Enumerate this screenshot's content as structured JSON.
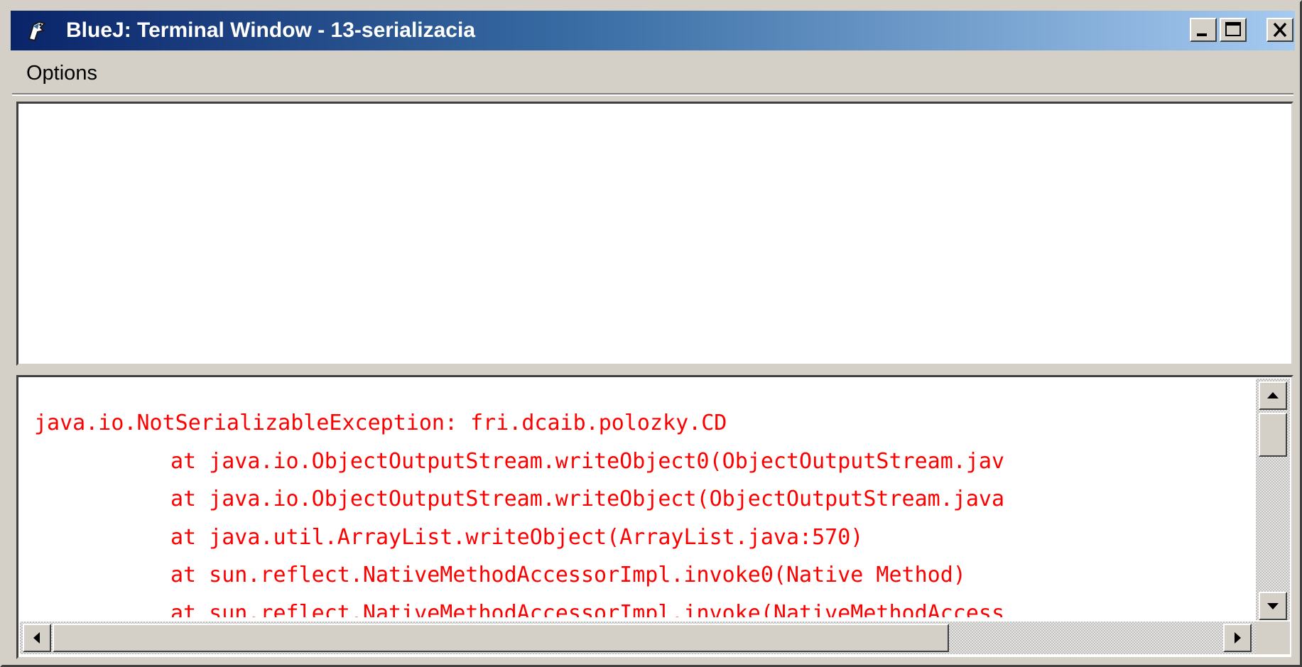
{
  "window": {
    "title": "BlueJ: Terminal Window - 13-serializacia",
    "icon": "bluej-bird-icon",
    "controls": [
      "minimize-icon",
      "maximize-icon",
      "close-icon"
    ]
  },
  "menu": {
    "options_label": "Options"
  },
  "console": {
    "text_color": "#ff0000",
    "lines": [
      "java.io.NotSerializableException: fri.dcaib.polozky.CD",
      "at java.io.ObjectOutputStream.writeObject0(ObjectOutputStream.jav",
      "at java.io.ObjectOutputStream.writeObject(ObjectOutputStream.java",
      "at java.util.ArrayList.writeObject(ArrayList.java:570)",
      "at sun.reflect.NativeMethodAccessorImpl.invoke0(Native Method)",
      "at sun.reflect.NativeMethodAccessorImpl.invoke(NativeMethodAccess"
    ]
  },
  "colors": {
    "titlebar_start": "#0a246a",
    "titlebar_end": "#a6caf0",
    "face": "#d4d0c8",
    "error_text": "#ff0000"
  }
}
